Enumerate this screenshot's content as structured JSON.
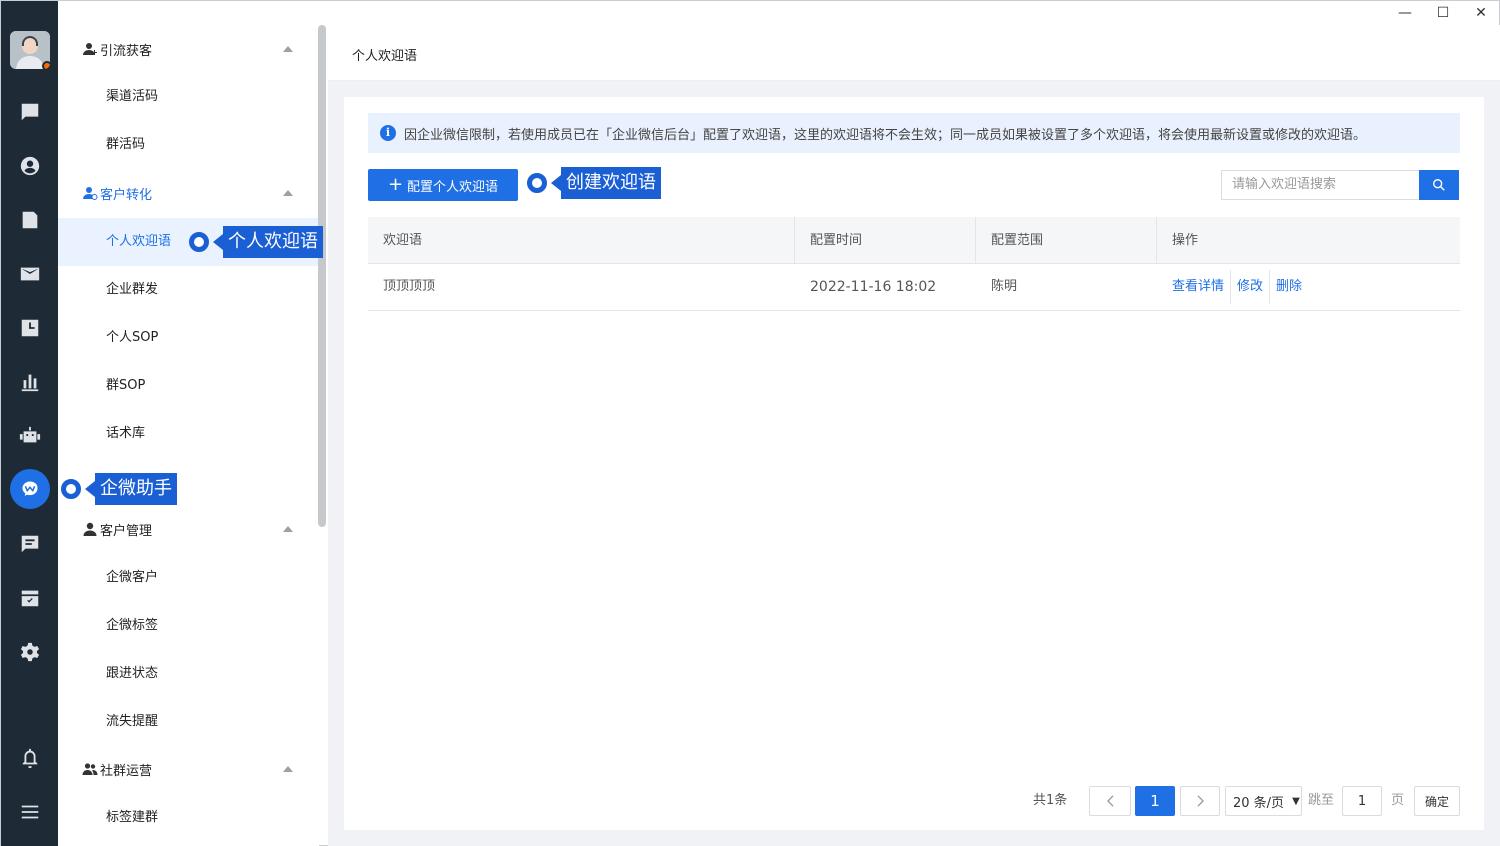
{
  "window": {
    "minimize": "—",
    "maximize": "☐",
    "close": "✕"
  },
  "rail": {
    "icons": [
      "avatar",
      "chat-icon",
      "contact-icon",
      "document-icon",
      "mail-icon",
      "calendar-icon",
      "chart-icon",
      "robot-icon",
      "wecom-assistant-icon",
      "message-icon",
      "task-icon",
      "settings-icon",
      "bell-icon",
      "menu-icon"
    ],
    "active": "wecom-assistant-icon"
  },
  "menu": {
    "groups": [
      {
        "label": "引流获客",
        "items": [
          "渠道活码",
          "群活码"
        ]
      },
      {
        "label": "客户转化",
        "items": [
          "个人欢迎语",
          "企业群发",
          "个人SOP",
          "群SOP",
          "话术库"
        ]
      },
      {
        "label": "客户管理",
        "items": [
          "企微客户",
          "企微标签",
          "跟进状态",
          "流失提醒"
        ]
      },
      {
        "label": "社群运营",
        "items": [
          "标签建群"
        ]
      }
    ],
    "active_item": "个人欢迎语"
  },
  "callouts": {
    "assistant": "企微助手",
    "welcome": "个人欢迎语",
    "create": "创建欢迎语"
  },
  "page": {
    "title": "个人欢迎语",
    "notice": "因企业微信限制，若使用成员已在「企业微信后台」配置了欢迎语，这里的欢迎语将不会生效；同一成员如果被设置了多个欢迎语，将会使用最新设置或修改的欢迎语。",
    "add_button": "配置个人欢迎语",
    "search_placeholder": "请输入欢迎语搜索"
  },
  "table": {
    "columns": [
      "欢迎语",
      "配置时间",
      "配置范围",
      "操作"
    ],
    "rows": [
      {
        "welcome": "顶顶顶顶",
        "time": "2022-11-16 18:02",
        "scope": "陈明",
        "actions": [
          "查看详情",
          "修改",
          "删除"
        ]
      }
    ]
  },
  "pagination": {
    "total": "共1条",
    "current": "1",
    "page_size": "20 条/页",
    "jump_label": "跳至",
    "jump_value": "1",
    "page_unit": "页",
    "confirm": "确定"
  },
  "colors": {
    "accent": "#1f6fe5",
    "rail": "#1e2a35",
    "callout": "#1a5fd4"
  }
}
